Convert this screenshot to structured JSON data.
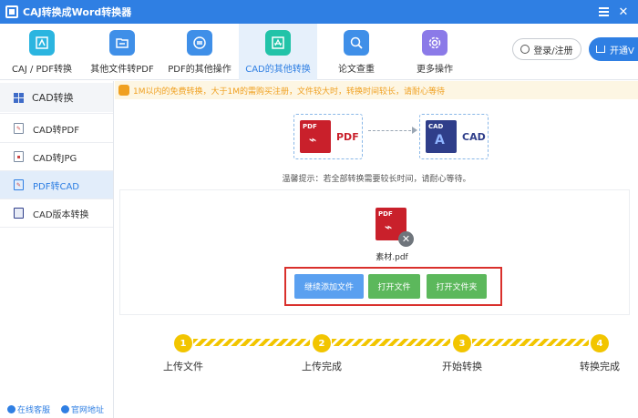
{
  "app": {
    "title": "CAJ转换成Word转换器"
  },
  "toolbar": {
    "items": [
      {
        "label": "CAJ / PDF转换",
        "icon": "caj-pdf-convert-icon",
        "color": "#2bb5e0"
      },
      {
        "label": "其他文件转PDF",
        "icon": "file-to-pdf-icon",
        "color": "#3f8fe8"
      },
      {
        "label": "PDF的其他操作",
        "icon": "pdf-operations-icon",
        "color": "#3f8fe8"
      },
      {
        "label": "CAD的其他转换",
        "icon": "cad-convert-icon",
        "color": "#22c3a8"
      },
      {
        "label": "论文查重",
        "icon": "paper-check-icon",
        "color": "#3f8fe8"
      },
      {
        "label": "更多操作",
        "icon": "settings-gear-icon",
        "color": "#8b7ae8"
      }
    ],
    "active_index": 3,
    "login_label": "登录/注册",
    "vip_label": "开通V"
  },
  "sidebar": {
    "header": "CAD转换",
    "items": [
      {
        "label": "CAD转PDF",
        "icon": "cad-to-pdf-icon"
      },
      {
        "label": "CAD转JPG",
        "icon": "cad-to-jpg-icon"
      },
      {
        "label": "PDF转CAD",
        "icon": "pdf-to-cad-icon"
      },
      {
        "label": "CAD版本转换",
        "icon": "cad-version-icon"
      }
    ],
    "active_index": 2,
    "footer": {
      "service": "在线客服",
      "website": "官网地址"
    }
  },
  "notice": "1M以内的免费转换，大于1M的需购买注册，文件较大时，转换时间较长，请耐心等待",
  "conversion": {
    "from_format": "PDF",
    "from_tag": "PDF",
    "to_format": "CAD",
    "to_tag": "CAD",
    "tip": "温馨提示：若全部转换需要较长时间，请耐心等待。"
  },
  "file": {
    "name": "素材.pdf",
    "tag": "PDF"
  },
  "actions": {
    "add_more": "继续添加文件",
    "open_file": "打开文件",
    "open_folder": "打开文件夹"
  },
  "steps": [
    {
      "number": "1",
      "label": "上传文件"
    },
    {
      "number": "2",
      "label": "上传完成"
    },
    {
      "number": "3",
      "label": "开始转换"
    },
    {
      "number": "4",
      "label": "转换完成"
    }
  ],
  "colors": {
    "accent": "#2f7fe3",
    "step_yellow": "#f2c500",
    "pdf_red": "#c9202b",
    "cad_navy": "#2f3e8a",
    "highlight_red": "#d9302c"
  }
}
